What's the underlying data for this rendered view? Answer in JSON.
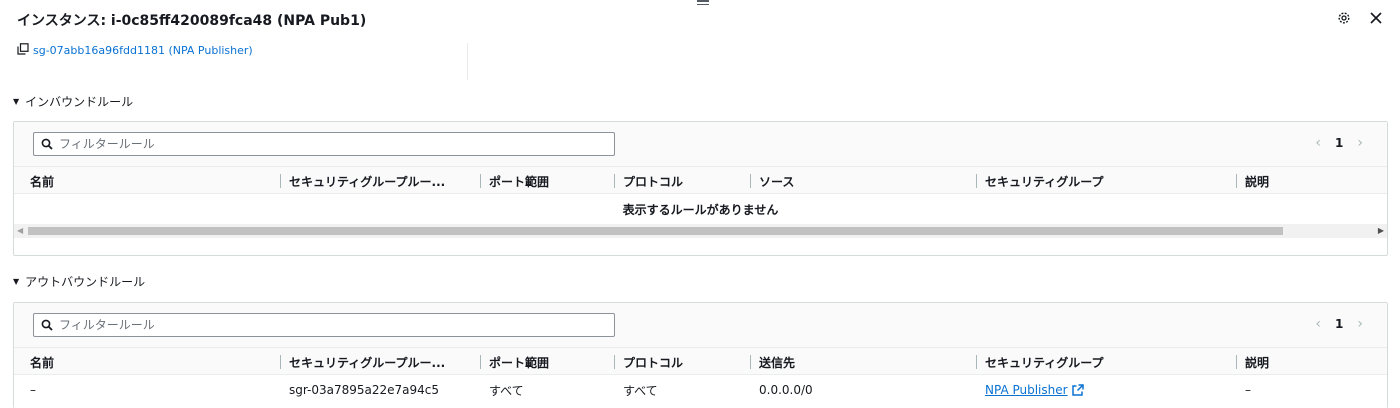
{
  "header": {
    "title": "インスタンス: i-0c85ff420089fca48 (NPA Pub1)",
    "settings_icon": "gear-icon",
    "close_icon": "close-icon"
  },
  "security_group_link": "sg-07abb16a96fdd1181 (NPA Publisher)",
  "inbound": {
    "title": "インバウンドルール",
    "search_placeholder": "フィルタールール",
    "page": "1",
    "columns": [
      "名前",
      "セキュリティグループルー...",
      "ポート範囲",
      "プロトコル",
      "ソース",
      "セキュリティグループ",
      "説明"
    ],
    "empty_message": "表示するルールがありません"
  },
  "outbound": {
    "title": "アウトバウンドルール",
    "search_placeholder": "フィルタールール",
    "page": "1",
    "columns": [
      "名前",
      "セキュリティグループルー...",
      "ポート範囲",
      "プロトコル",
      "送信先",
      "セキュリティグループ",
      "説明"
    ],
    "rows": [
      {
        "name": "–",
        "rule_id": "sgr-03a7895a22e7a94c5",
        "port_range": "すべて",
        "protocol": "すべて",
        "destination": "0.0.0.0/0",
        "security_group": "NPA Publisher",
        "description": "–"
      }
    ]
  },
  "colors": {
    "link": "#0972d3",
    "text": "#16191f",
    "border": "#d5dbdb"
  }
}
